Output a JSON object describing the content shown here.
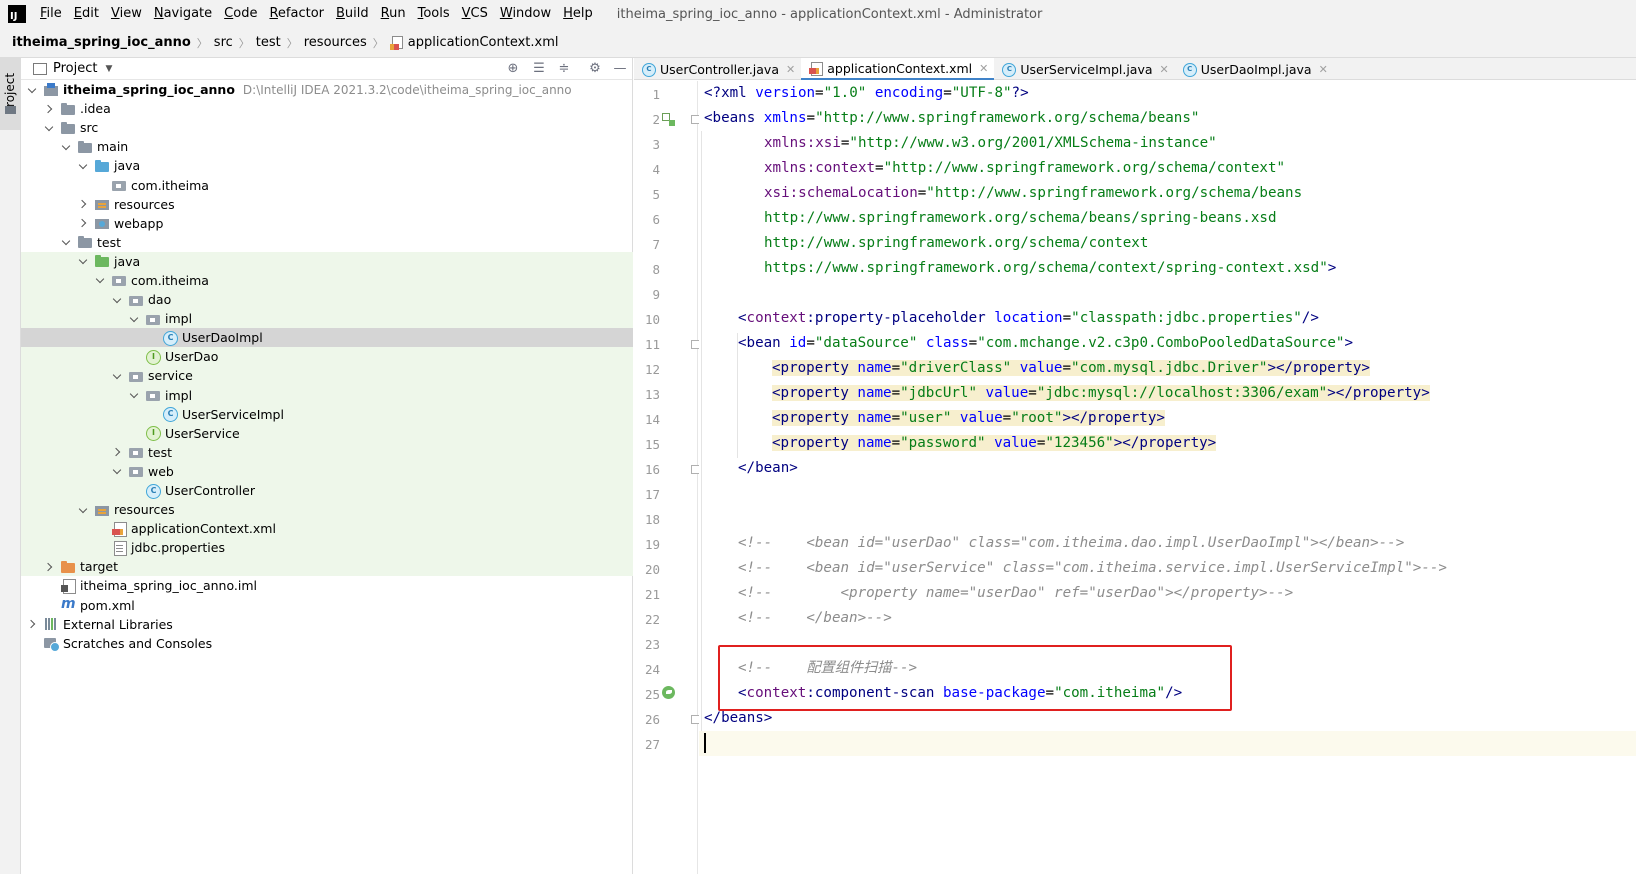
{
  "menubar": {
    "logo": "IJ",
    "items": [
      "File",
      "Edit",
      "View",
      "Navigate",
      "Code",
      "Refactor",
      "Build",
      "Run",
      "Tools",
      "VCS",
      "Window",
      "Help"
    ],
    "title": "itheima_spring_ioc_anno - applicationContext.xml - Administrator"
  },
  "breadcrumb": {
    "items": [
      "itheima_spring_ioc_anno",
      "src",
      "test",
      "resources",
      "applicationContext.xml"
    ]
  },
  "stripe": {
    "project_label": "Project"
  },
  "project_panel": {
    "title": "Project",
    "tree": [
      {
        "label": "itheima_spring_ioc_anno",
        "path": "D:\\IntelliJ IDEA 2021.3.2\\code\\itheima_spring_ioc_anno"
      },
      {
        "label": ".idea"
      },
      {
        "label": "src"
      },
      {
        "label": "main"
      },
      {
        "label": "java"
      },
      {
        "label": "com.itheima"
      },
      {
        "label": "resources"
      },
      {
        "label": "webapp"
      },
      {
        "label": "test"
      },
      {
        "label": "java"
      },
      {
        "label": "com.itheima"
      },
      {
        "label": "dao"
      },
      {
        "label": "impl"
      },
      {
        "label": "UserDaoImpl"
      },
      {
        "label": "UserDao"
      },
      {
        "label": "service"
      },
      {
        "label": "impl"
      },
      {
        "label": "UserServiceImpl"
      },
      {
        "label": "UserService"
      },
      {
        "label": "test"
      },
      {
        "label": "web"
      },
      {
        "label": "UserController"
      },
      {
        "label": "resources"
      },
      {
        "label": "applicationContext.xml"
      },
      {
        "label": "jdbc.properties"
      },
      {
        "label": "target"
      },
      {
        "label": "itheima_spring_ioc_anno.iml"
      },
      {
        "label": "pom.xml"
      },
      {
        "label": "External Libraries"
      },
      {
        "label": "Scratches and Consoles"
      }
    ]
  },
  "editor": {
    "tabs": [
      {
        "label": "UserController.java"
      },
      {
        "label": "applicationContext.xml"
      },
      {
        "label": "UserServiceImpl.java"
      },
      {
        "label": "UserDaoImpl.java"
      }
    ],
    "line_numbers": [
      "1",
      "2",
      "3",
      "4",
      "5",
      "6",
      "7",
      "8",
      "9",
      "10",
      "11",
      "12",
      "13",
      "14",
      "15",
      "16",
      "17",
      "18",
      "19",
      "20",
      "21",
      "22",
      "23",
      "24",
      "25",
      "26",
      "27"
    ],
    "code": {
      "l1_a": "<?xml ",
      "l1_b": "version",
      "l1_c": "=",
      "l1_d": "\"1.0\"",
      "l1_e": " encoding",
      "l1_f": "=",
      "l1_g": "\"UTF-8\"",
      "l1_h": "?>",
      "l2_a": "<beans ",
      "l2_b": "xmlns",
      "l2_c": "=",
      "l2_d": "\"http://www.springframework.org/schema/beans\"",
      "l3_a": "xmlns:xsi",
      "l3_b": "=",
      "l3_c": "\"http://www.w3.org/2001/XMLSchema-instance\"",
      "l4_a": "xmlns:context",
      "l4_b": "=",
      "l4_c": "\"http://www.springframework.org/schema/context\"",
      "l5_a": "xsi:schemaLocation",
      "l5_b": "=",
      "l5_c": "\"http://www.springframework.org/schema/beans",
      "l6": "http://www.springframework.org/schema/beans/spring-beans.xsd",
      "l7": "http://www.springframework.org/schema/context",
      "l8_a": "https://www.springframework.org/schema/context/spring-context.xsd\"",
      "l8_b": ">",
      "l10_a": "<",
      "l10_b": "context",
      "l10_c": ":property-placeholder ",
      "l10_d": "location",
      "l10_e": "=",
      "l10_f": "\"classpath:jdbc.properties\"",
      "l10_g": "/>",
      "l11_a": "<bean ",
      "l11_b": "id",
      "l11_c": "=",
      "l11_d": "\"dataSource\"",
      "l11_e": " class",
      "l11_f": "=",
      "l11_g": "\"com.mchange.v2.c3p0.ComboPooledDataSource\"",
      "l11_h": ">",
      "l12_a": "<property ",
      "l12_b": "name",
      "l12_c": "=",
      "l12_d": "\"driverClass\"",
      "l12_e": " value",
      "l12_f": "=",
      "l12_g": "\"com.mysql.jdbc.Driver\"",
      "l12_h": "></property>",
      "l13_a": "<property ",
      "l13_b": "name",
      "l13_c": "=",
      "l13_d": "\"jdbcUrl\"",
      "l13_e": " value",
      "l13_f": "=",
      "l13_g": "\"jdbc:mysql://localhost:3306/exam\"",
      "l13_h": "></property>",
      "l14_a": "<property ",
      "l14_b": "name",
      "l14_c": "=",
      "l14_d": "\"user\"",
      "l14_e": " value",
      "l14_f": "=",
      "l14_g": "\"root\"",
      "l14_h": "></property>",
      "l15_a": "<property ",
      "l15_b": "name",
      "l15_c": "=",
      "l15_d": "\"password\"",
      "l15_e": " value",
      "l15_f": "=",
      "l15_g": "\"123456\"",
      "l15_h": "></property>",
      "l16": "</bean>",
      "l19": "<!--    <bean id=\"userDao\" class=\"com.itheima.dao.impl.UserDaoImpl\"></bean>-->",
      "l20": "<!--    <bean id=\"userService\" class=\"com.itheima.service.impl.UserServiceImpl\">-->",
      "l21": "<!--        <property name=\"userDao\" ref=\"userDao\"></property>-->",
      "l22": "<!--    </bean>-->",
      "l24": "<!--    配置组件扫描-->",
      "l25_a": "<",
      "l25_b": "context",
      "l25_c": ":component-scan ",
      "l25_d": "base-package",
      "l25_e": "=",
      "l25_f": "\"com.itheima\"",
      "l25_g": "/>",
      "l26": "</beans>"
    }
  },
  "colors": {
    "annotation_box": "#e0201f",
    "test_source_bg": "#eef7ea",
    "selected_row": "#d5d5d5",
    "property_highlight": "#f7efce"
  }
}
